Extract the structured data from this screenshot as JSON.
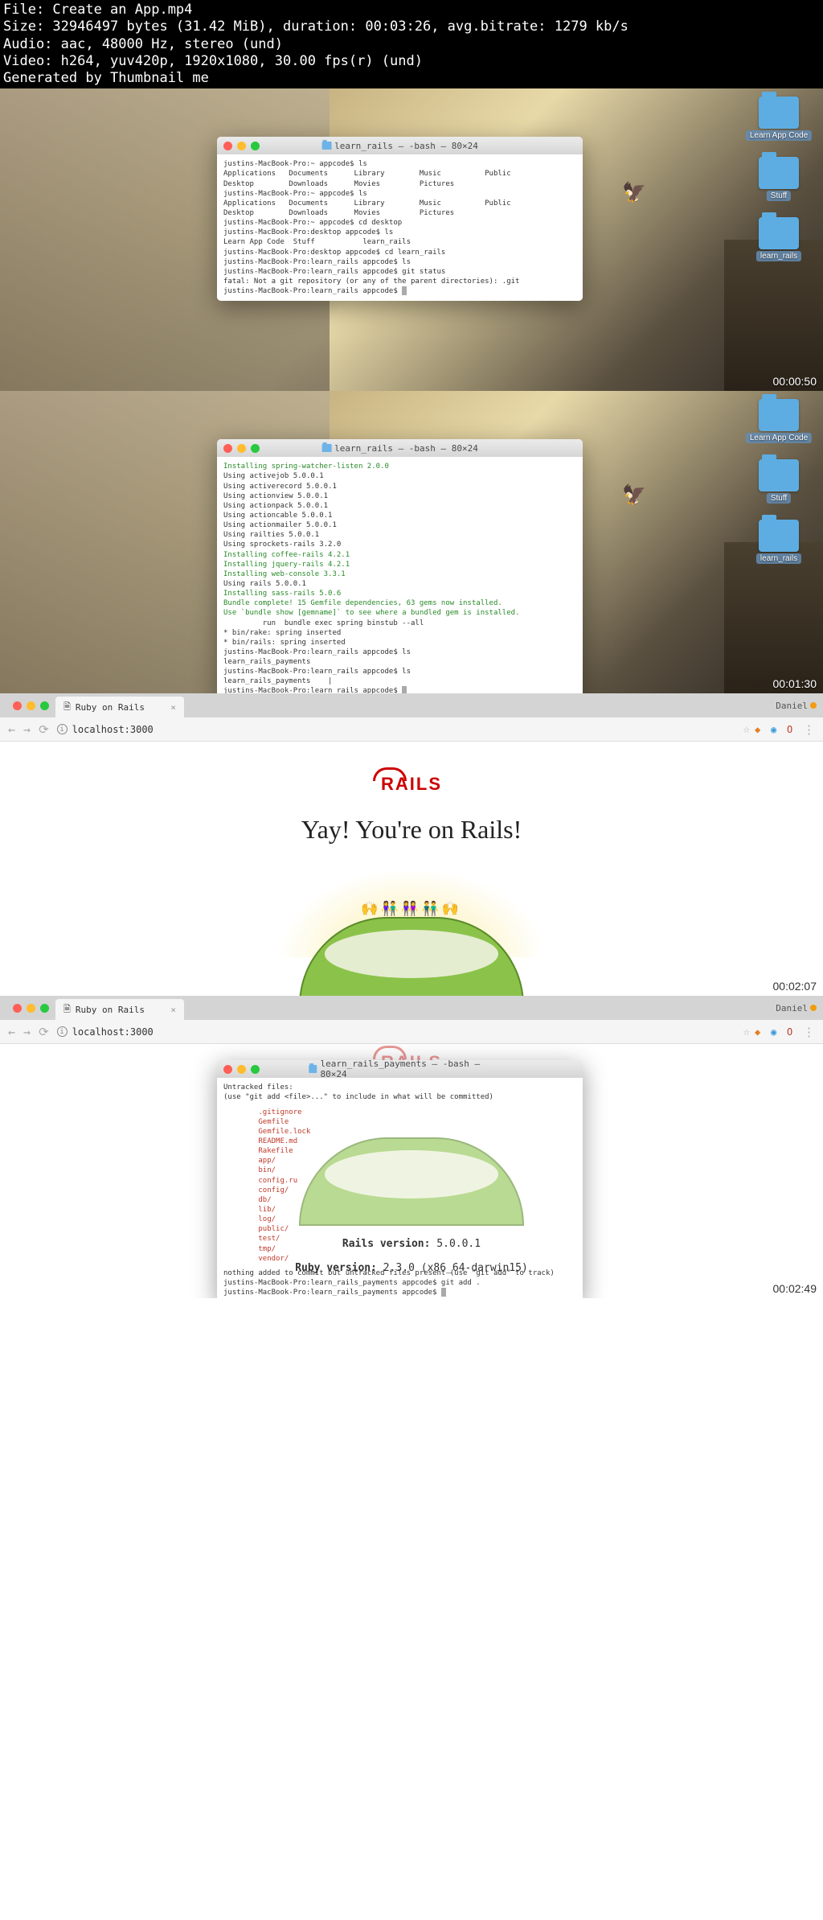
{
  "header": {
    "file": "File: Create an App.mp4",
    "size": "Size: 32946497 bytes (31.42 MiB), duration: 00:03:26, avg.bitrate: 1279 kb/s",
    "audio": "Audio: aac, 48000 Hz, stereo (und)",
    "video": "Video: h264, yuv420p, 1920x1080, 30.00 fps(r) (und)",
    "gen": "Generated by Thumbnail me"
  },
  "folders": {
    "code": "Learn App Code",
    "stuff": "Stuff",
    "rails": "learn_rails"
  },
  "timestamps": {
    "s1": "00:00:50",
    "s2": "00:01:30",
    "s3": "00:02:07",
    "s4": "00:02:49"
  },
  "term1": {
    "title": "learn_rails — -bash — 80×24",
    "l1": "justins-MacBook-Pro:~ appcode$ ls",
    "cols1a": "Applications   Documents      Library        Music          Public",
    "cols1b": "Desktop        Downloads      Movies         Pictures",
    "l2": "justins-MacBook-Pro:~ appcode$ ls",
    "cols2a": "Applications   Documents      Library        Music          Public",
    "cols2b": "Desktop        Downloads      Movies         Pictures",
    "l3": "justins-MacBook-Pro:~ appcode$ cd desktop",
    "l4": "justins-MacBook-Pro:desktop appcode$ ls",
    "cols3": "Learn App Code  Stuff           learn_rails",
    "l5": "justins-MacBook-Pro:desktop appcode$ cd learn_rails",
    "l6": "justins-MacBook-Pro:learn_rails appcode$ ls",
    "l7": "justins-MacBook-Pro:learn_rails appcode$ git status",
    "l8": "fatal: Not a git repository (or any of the parent directories): .git",
    "l9": "justins-MacBook-Pro:learn_rails appcode$ "
  },
  "term2": {
    "title": "learn_rails — -bash — 80×24",
    "g1": "Installing spring-watcher-listen 2.0.0",
    "l1": "Using activejob 5.0.0.1",
    "l2": "Using activerecord 5.0.0.1",
    "l3": "Using actionview 5.0.0.1",
    "l4": "Using actionpack 5.0.0.1",
    "l5": "Using actioncable 5.0.0.1",
    "l6": "Using actionmailer 5.0.0.1",
    "l7": "Using railties 5.0.0.1",
    "l8": "Using sprockets-rails 3.2.0",
    "g2": "Installing coffee-rails 4.2.1",
    "g3": "Installing jquery-rails 4.2.1",
    "g4": "Installing web-console 3.3.1",
    "l9": "Using rails 5.0.0.1",
    "g5": "Installing sass-rails 5.0.6",
    "g6": "Bundle complete! 15 Gemfile dependencies, 63 gems now installed.",
    "g7": "Use `bundle show [gemname]` to see where a bundled gem is installed.",
    "l10": "         run  bundle exec spring binstub --all",
    "l11": "* bin/rake: spring inserted",
    "l12": "* bin/rails: spring inserted",
    "l13": "justins-MacBook-Pro:learn_rails appcode$ ls",
    "l14": "learn_rails_payments",
    "l15": "justins-MacBook-Pro:learn_rails appcode$ ls",
    "l16": "learn_rails_payments    |",
    "l17": "justins-MacBook-Pro:learn_rails appcode$ "
  },
  "browser": {
    "tab": "Ruby on Rails",
    "user": "Daniel",
    "url": "localhost:3000",
    "heading": "Yay! You're on Rails!",
    "rails_version_label": "Rails version:",
    "rails_version": "5.0.0.1",
    "ruby_version_label": "Ruby version:",
    "ruby_version": "2.3.0 (x86_64-darwin15)"
  },
  "term3": {
    "title": "learn_rails_payments — -bash — 80×24",
    "l1": "Untracked files:",
    "l2": "  (use \"git add <file>...\" to include in what will be committed)",
    "r1": "\t.gitignore",
    "r2": "\tGemfile",
    "r3": "\tGemfile.lock",
    "r4": "\tREADME.md",
    "r5": "\tRakefile",
    "r6": "\tapp/",
    "r7": "\tbin/",
    "r8": "\tconfig.ru",
    "r9": "\tconfig/",
    "r10": "\tdb/",
    "r11": "\tlib/",
    "r12": "\tlog/",
    "r13": "\tpublic/",
    "r14": "\ttest/",
    "r15": "\ttmp/",
    "r16": "\tvendor/",
    "l3": "nothing added to commit but untracked files present (use \"git add\" to track)",
    "l4": "justins-MacBook-Pro:learn_rails_payments appcode$ git add .",
    "l5": "justins-MacBook-Pro:learn_rails_payments appcode$ "
  }
}
